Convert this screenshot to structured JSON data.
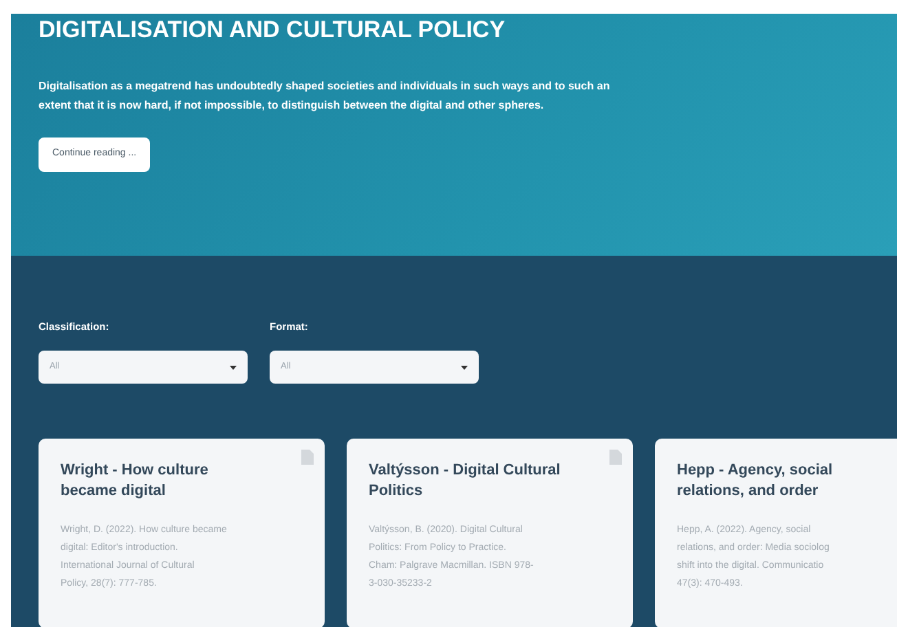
{
  "hero": {
    "title": "DIGITALISATION AND CULTURAL POLICY",
    "text": "Digitalisation as a megatrend has undoubtedly shaped societies and individuals in such ways and to such an extent that it is now hard, if not impossible, to distinguish between the digital and other spheres.",
    "button": "Continue reading ..."
  },
  "filters": [
    {
      "label": "Classification:",
      "value": "All"
    },
    {
      "label": "Format:",
      "value": "All"
    }
  ],
  "cards": [
    {
      "title": "Wright - How culture became digital",
      "lines": [
        "Wright, D. (2022). How culture became",
        "digital: Editor's introduction.",
        "International Journal of Cultural",
        "Policy, 28(7): 777-785."
      ],
      "document_icon": true
    },
    {
      "title": "Valtýsson - Digital Cultural Politics",
      "lines": [
        "Valtýsson, B. (2020). Digital Cultural",
        "Politics: From Policy to Practice.",
        "Cham: Palgrave Macmillan. ISBN 978-",
        "3-030-35233-2"
      ],
      "document_icon": true
    },
    {
      "title": "Hepp - Agency, social relations, and order",
      "lines": [
        "Hepp, A. (2022). Agency, social",
        "relations, and order: Media sociolog",
        "shift into the digital. Communicatio",
        "47(3): 470-493."
      ],
      "document_icon": false
    }
  ]
}
